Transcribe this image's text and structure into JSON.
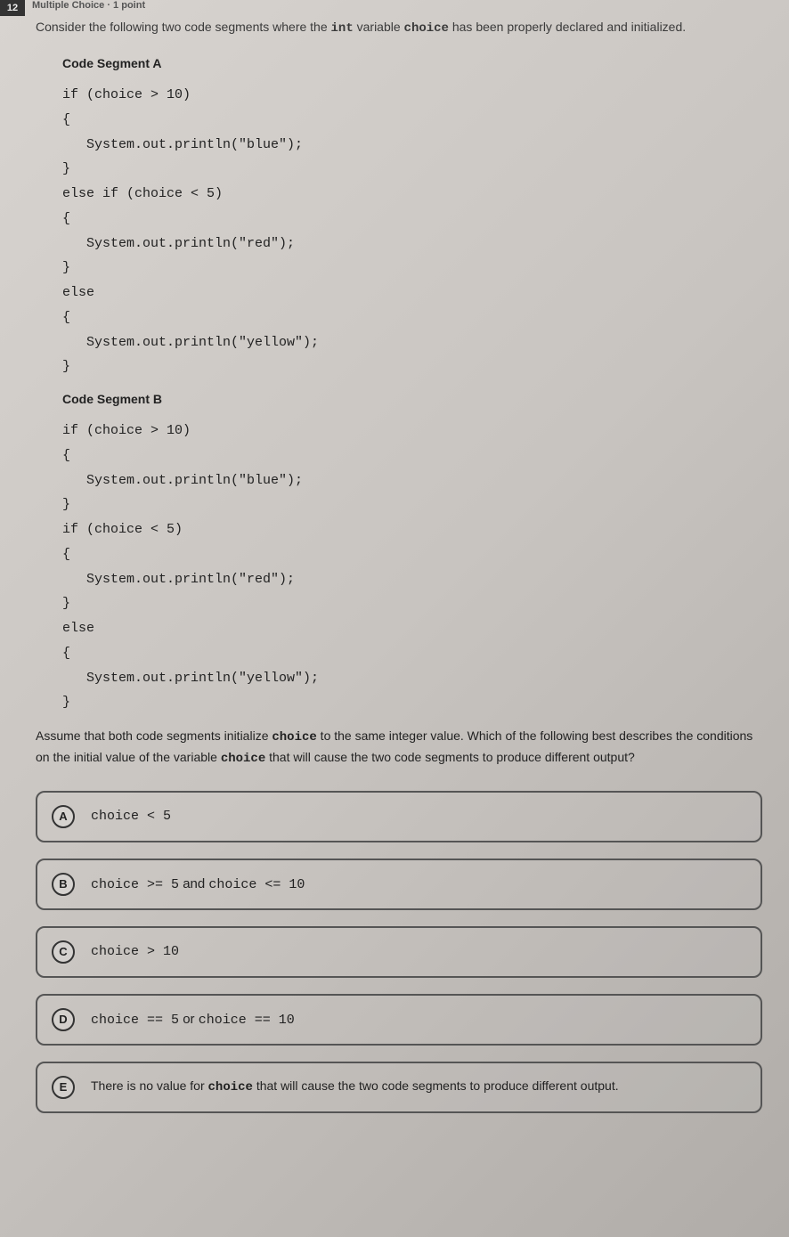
{
  "header": {
    "qnum": "12",
    "qtype": "Multiple Choice · 1 point"
  },
  "prompt": {
    "p1a": "Consider the following two code segments where the ",
    "p1_var1": "int",
    "p1b": " variable ",
    "p1_var2": "choice",
    "p1c": " has been properly declared and initialized."
  },
  "segA": {
    "title": "Code Segment A",
    "code": "if (choice > 10)\n{\n   System.out.println(\"blue\");\n}\nelse if (choice < 5)\n{\n   System.out.println(\"red\");\n}\nelse\n{\n   System.out.println(\"yellow\");\n}"
  },
  "segB": {
    "title": "Code Segment B",
    "code": "if (choice > 10)\n{\n   System.out.println(\"blue\");\n}\nif (choice < 5)\n{\n   System.out.println(\"red\");\n}\nelse\n{\n   System.out.println(\"yellow\");\n}"
  },
  "finalq": {
    "t1": "Assume that both code segments initialize ",
    "v1": "choice",
    "t2": " to the same integer value. Which of the following best describes the conditions on the initial value of the variable ",
    "v2": "choice",
    "t3": " that will cause the two code segments to produce different output?"
  },
  "options": {
    "a": {
      "letter": "A",
      "text": "choice < 5"
    },
    "b": {
      "letter": "B",
      "pre": "choice >= 5",
      "mid": " and ",
      "post": "choice <= 10"
    },
    "c": {
      "letter": "C",
      "text": "choice > 10"
    },
    "d": {
      "letter": "D",
      "pre": "choice == 5",
      "mid": " or ",
      "post": "choice == 10"
    },
    "e": {
      "letter": "E",
      "t1": "There is no value for ",
      "v": "choice",
      "t2": " that will cause the two code segments to produce different output."
    }
  }
}
